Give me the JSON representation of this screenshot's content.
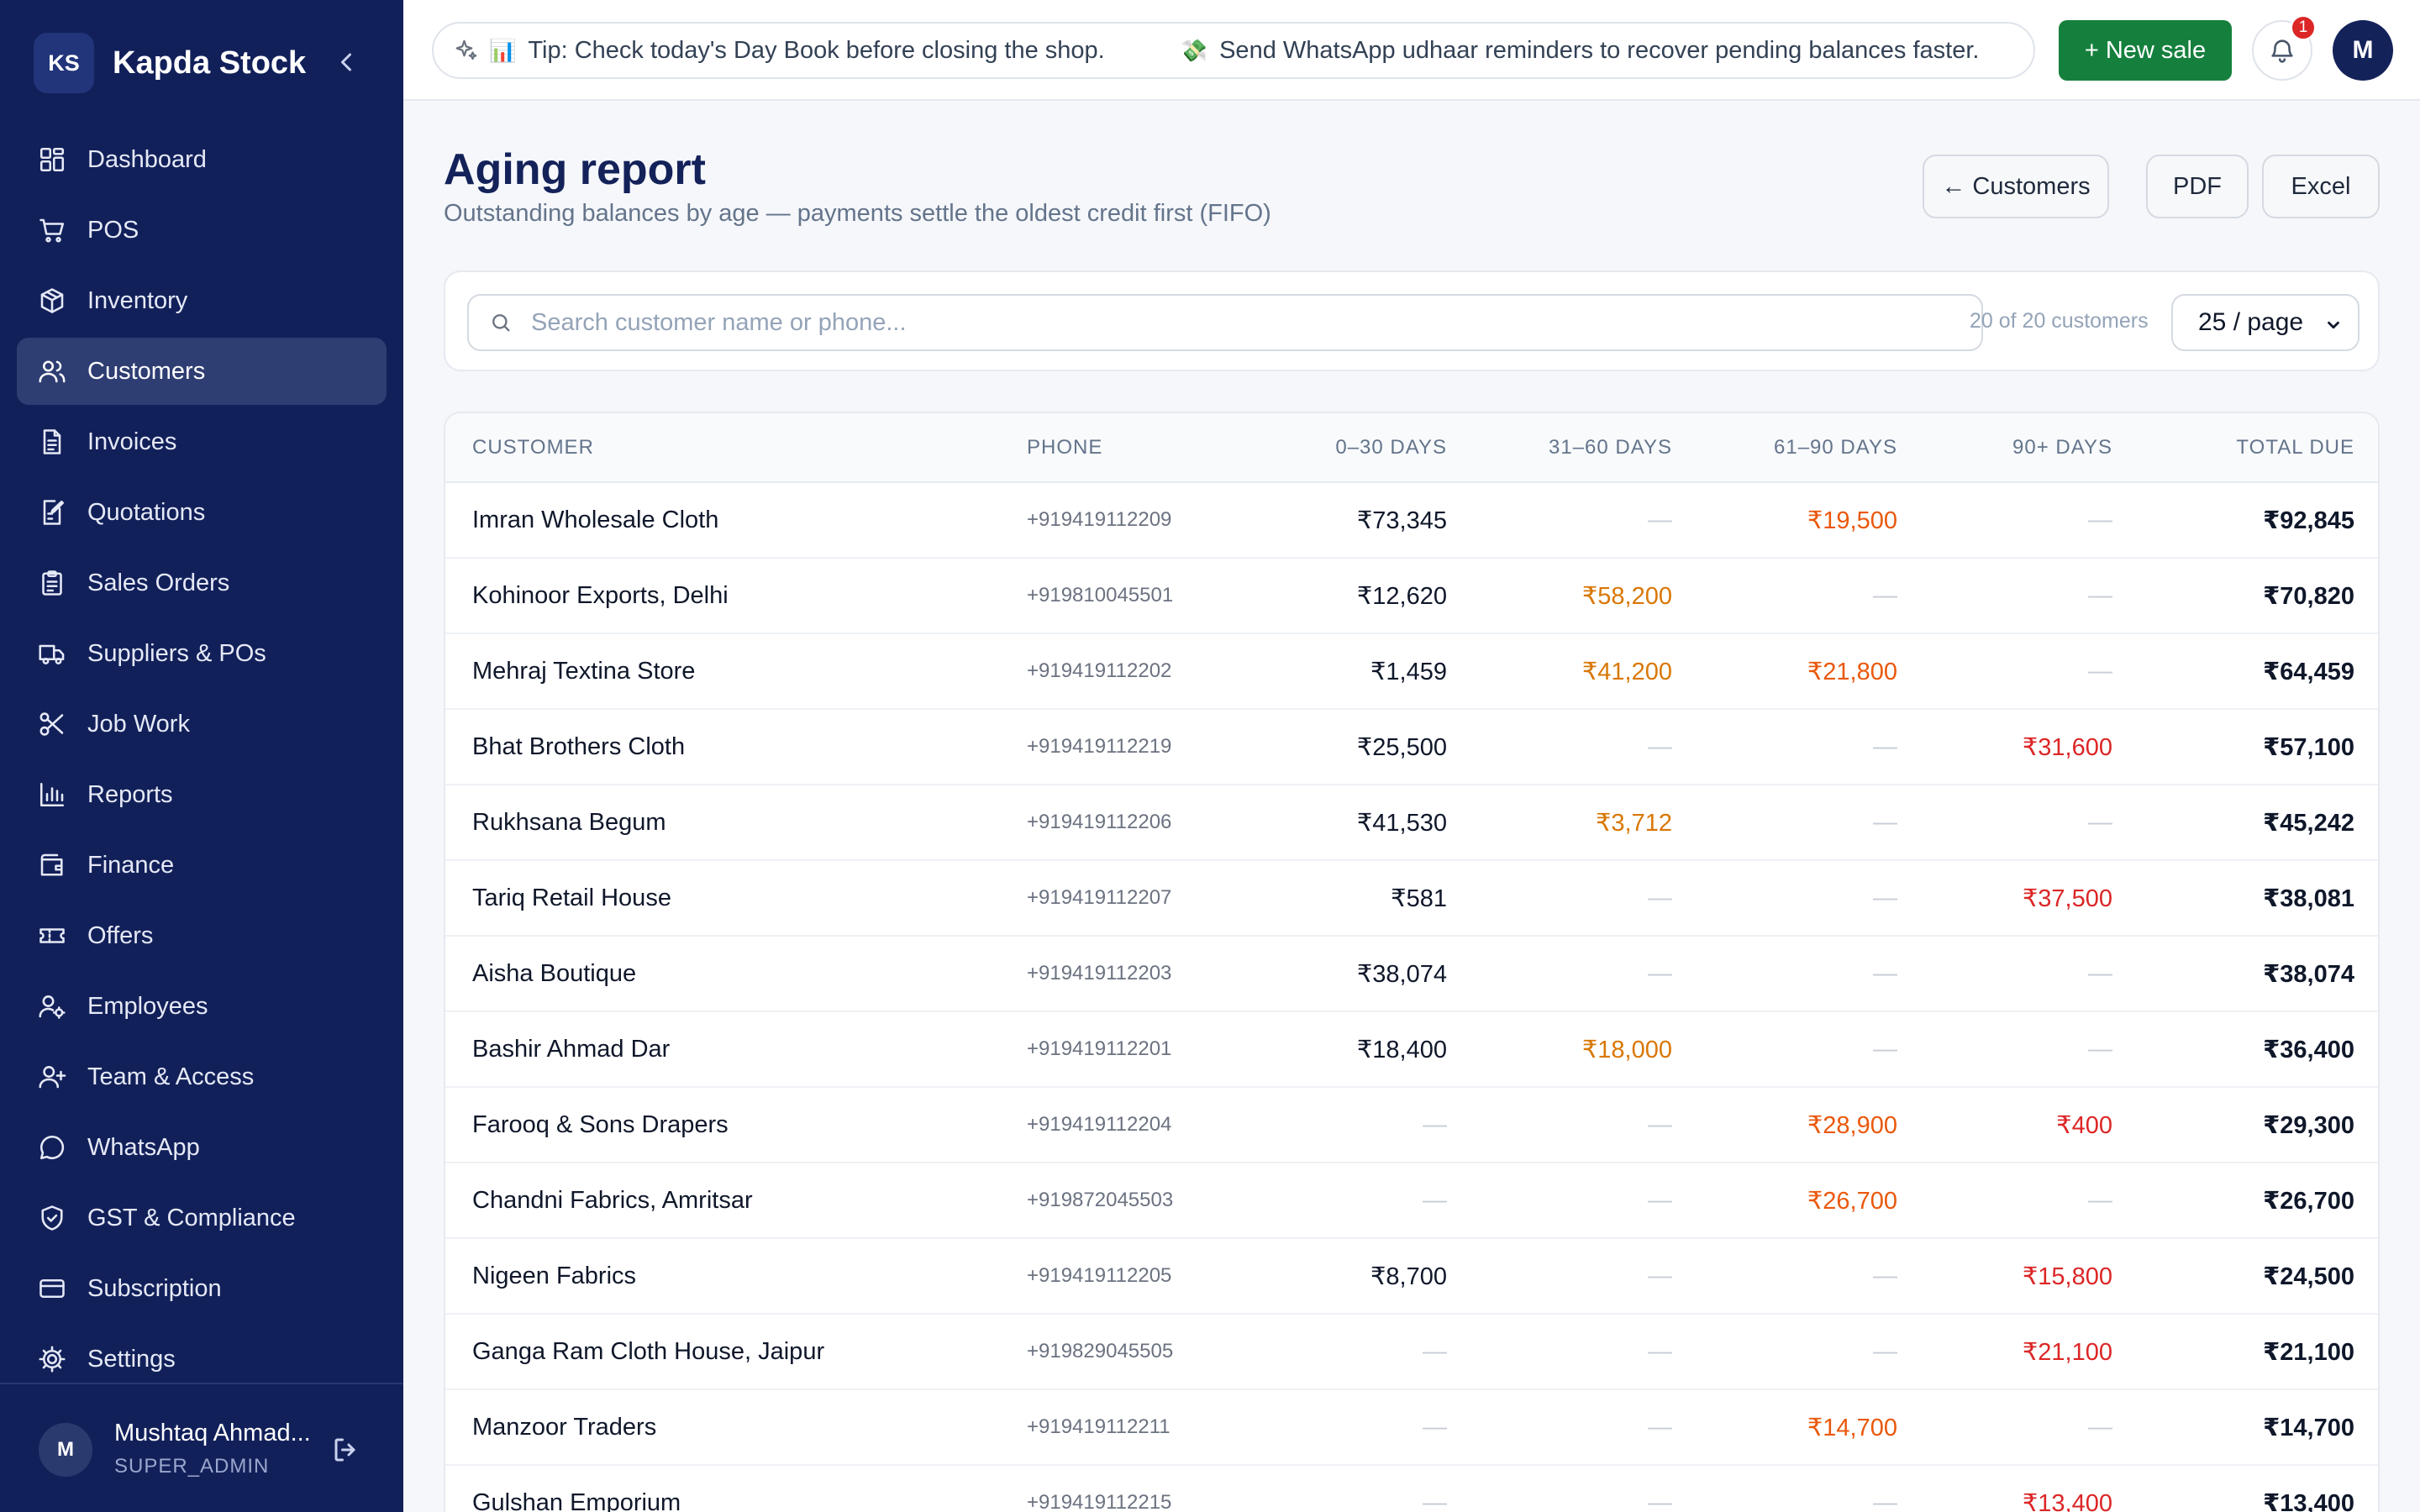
{
  "brand": {
    "initials": "KS",
    "name": "Kapda Stock"
  },
  "nav": [
    {
      "label": "Dashboard",
      "icon": "dashboard-icon",
      "active": false
    },
    {
      "label": "POS",
      "icon": "cart-icon",
      "active": false
    },
    {
      "label": "Inventory",
      "icon": "box-icon",
      "active": false
    },
    {
      "label": "Customers",
      "icon": "users-icon",
      "active": true
    },
    {
      "label": "Invoices",
      "icon": "invoice-icon",
      "active": false
    },
    {
      "label": "Quotations",
      "icon": "quotation-icon",
      "active": false
    },
    {
      "label": "Sales Orders",
      "icon": "clipboard-icon",
      "active": false
    },
    {
      "label": "Suppliers & POs",
      "icon": "truck-icon",
      "active": false
    },
    {
      "label": "Job Work",
      "icon": "scissors-icon",
      "active": false
    },
    {
      "label": "Reports",
      "icon": "bar-chart-icon",
      "active": false
    },
    {
      "label": "Finance",
      "icon": "wallet-icon",
      "active": false
    },
    {
      "label": "Offers",
      "icon": "ticket-icon",
      "active": false
    },
    {
      "label": "Employees",
      "icon": "employee-icon",
      "active": false
    },
    {
      "label": "Team & Access",
      "icon": "user-plus-icon",
      "active": false
    },
    {
      "label": "WhatsApp",
      "icon": "chat-icon",
      "active": false
    },
    {
      "label": "GST & Compliance",
      "icon": "shield-icon",
      "active": false
    },
    {
      "label": "Subscription",
      "icon": "card-icon",
      "active": false
    },
    {
      "label": "Settings",
      "icon": "gear-icon",
      "active": false
    }
  ],
  "user": {
    "initial": "M",
    "name": "Mushtaq Ahmad...",
    "role": "SUPER_ADMIN"
  },
  "topbar": {
    "tips": [
      {
        "icon": "📊",
        "text": "Tip: Check today's Day Book before closing the shop."
      },
      {
        "icon": "💸",
        "text": "Send WhatsApp udhaar reminders to recover pending balances faster."
      }
    ],
    "new_sale": "+ New sale",
    "notification_count": "1",
    "avatar_initial": "M"
  },
  "page": {
    "title": "Aging report",
    "subtitle": "Outstanding balances by age — payments settle the oldest credit first (FIFO)",
    "btn_customers": "← Customers",
    "btn_pdf": "PDF",
    "btn_excel": "Excel"
  },
  "filters": {
    "search_placeholder": "Search customer name or phone...",
    "count": "20 of 20 customers",
    "per_page": "25 / page"
  },
  "table": {
    "headers": [
      "CUSTOMER",
      "PHONE",
      "0–30 DAYS",
      "31–60 DAYS",
      "61–90 DAYS",
      "90+ DAYS",
      "TOTAL DUE"
    ],
    "rows": [
      {
        "name": "Imran Wholesale Cloth",
        "phone": "+919419112209",
        "d0": "₹73,345",
        "d31": "—",
        "d61": "₹19,500",
        "d90": "—",
        "total": "₹92,845"
      },
      {
        "name": "Kohinoor Exports, Delhi",
        "phone": "+919810045501",
        "d0": "₹12,620",
        "d31": "₹58,200",
        "d61": "—",
        "d90": "—",
        "total": "₹70,820"
      },
      {
        "name": "Mehraj Textina Store",
        "phone": "+919419112202",
        "d0": "₹1,459",
        "d31": "₹41,200",
        "d61": "₹21,800",
        "d90": "—",
        "total": "₹64,459"
      },
      {
        "name": "Bhat Brothers Cloth",
        "phone": "+919419112219",
        "d0": "₹25,500",
        "d31": "—",
        "d61": "—",
        "d90": "₹31,600",
        "total": "₹57,100"
      },
      {
        "name": "Rukhsana Begum",
        "phone": "+919419112206",
        "d0": "₹41,530",
        "d31": "₹3,712",
        "d61": "—",
        "d90": "—",
        "total": "₹45,242"
      },
      {
        "name": "Tariq Retail House",
        "phone": "+919419112207",
        "d0": "₹581",
        "d31": "—",
        "d61": "—",
        "d90": "₹37,500",
        "total": "₹38,081"
      },
      {
        "name": "Aisha Boutique",
        "phone": "+919419112203",
        "d0": "₹38,074",
        "d31": "—",
        "d61": "—",
        "d90": "—",
        "total": "₹38,074"
      },
      {
        "name": "Bashir Ahmad Dar",
        "phone": "+919419112201",
        "d0": "₹18,400",
        "d31": "₹18,000",
        "d61": "—",
        "d90": "—",
        "total": "₹36,400"
      },
      {
        "name": "Farooq & Sons Drapers",
        "phone": "+919419112204",
        "d0": "—",
        "d31": "—",
        "d61": "₹28,900",
        "d90": "₹400",
        "total": "₹29,300"
      },
      {
        "name": "Chandni Fabrics, Amritsar",
        "phone": "+919872045503",
        "d0": "—",
        "d31": "—",
        "d61": "₹26,700",
        "d90": "—",
        "total": "₹26,700"
      },
      {
        "name": "Nigeen Fabrics",
        "phone": "+919419112205",
        "d0": "₹8,700",
        "d31": "—",
        "d61": "—",
        "d90": "₹15,800",
        "total": "₹24,500"
      },
      {
        "name": "Ganga Ram Cloth House, Jaipur",
        "phone": "+919829045505",
        "d0": "—",
        "d31": "—",
        "d61": "—",
        "d90": "₹21,100",
        "total": "₹21,100"
      },
      {
        "name": "Manzoor Traders",
        "phone": "+919419112211",
        "d0": "—",
        "d31": "—",
        "d61": "₹14,700",
        "d90": "—",
        "total": "₹14,700"
      },
      {
        "name": "Gulshan Emporium",
        "phone": "+919419112215",
        "d0": "—",
        "d31": "—",
        "d61": "—",
        "d90": "₹13,400",
        "total": "₹13,400"
      }
    ]
  },
  "colors": {
    "sidebar": "#12205a",
    "active_nav": "#2e3d72",
    "new_sale": "#15803d",
    "bucket_31_60": "#d97706",
    "bucket_61_90": "#ea580c",
    "bucket_90_plus": "#dc2626"
  }
}
